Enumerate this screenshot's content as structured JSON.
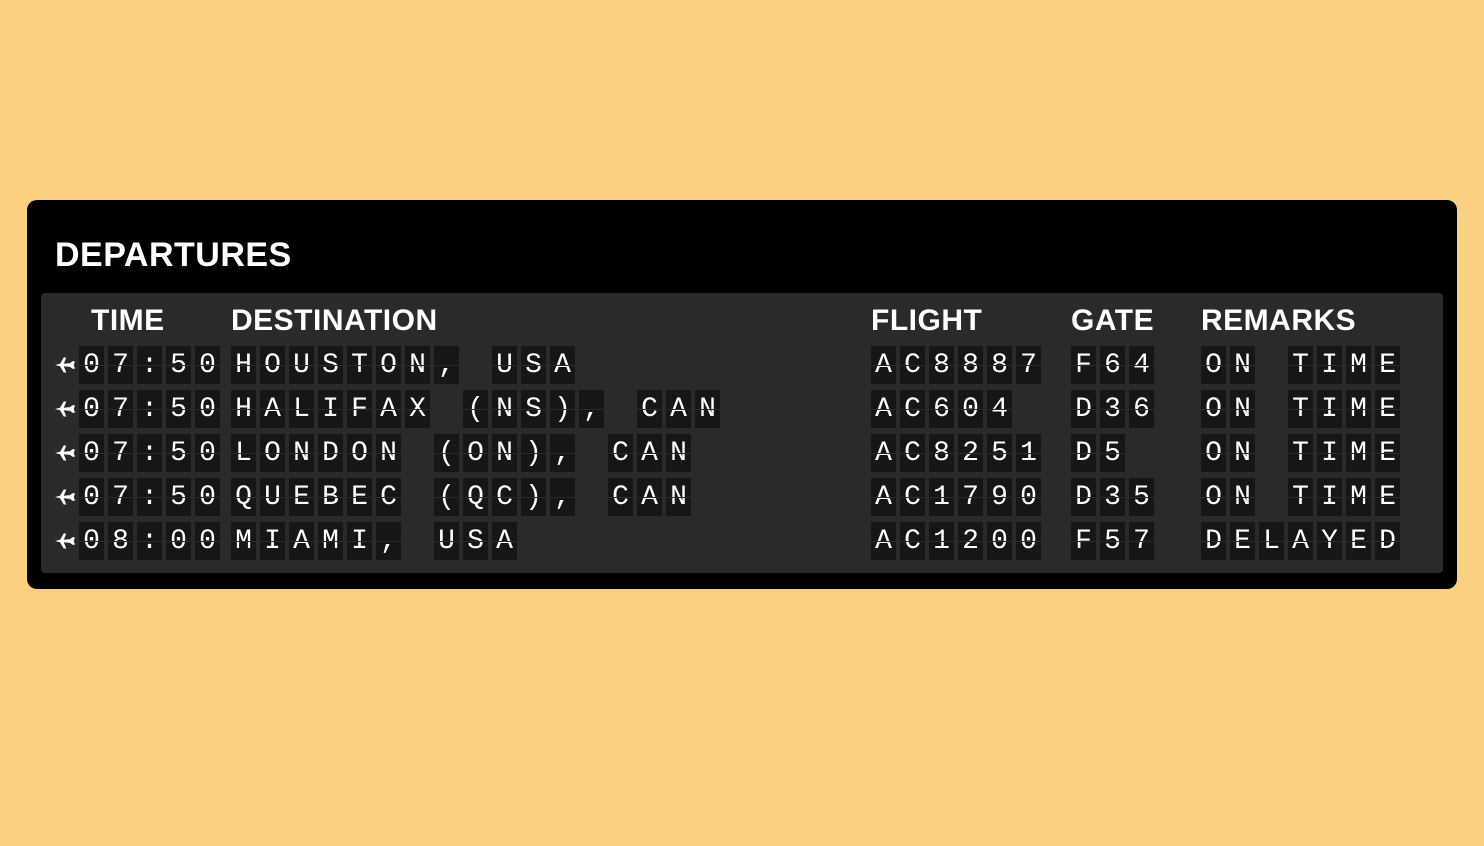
{
  "board": {
    "title": "DEPARTURES",
    "columns": {
      "time": "TIME",
      "destination": "DESTINATION",
      "flight": "FLIGHT",
      "gate": "GATE",
      "remarks": "REMARKS"
    },
    "rows": [
      {
        "time": "07:50",
        "destination": "HOUSTON, USA",
        "flight": "AC8887",
        "gate": "F64",
        "remarks": "ON TIME"
      },
      {
        "time": "07:50",
        "destination": "HALIFAX (NS), CAN",
        "flight": "AC604",
        "gate": "D36",
        "remarks": "ON TIME"
      },
      {
        "time": "07:50",
        "destination": "LONDON (ON), CAN",
        "flight": "AC8251",
        "gate": "D5",
        "remarks": "ON TIME"
      },
      {
        "time": "07:50",
        "destination": "QUEBEC (QC), CAN",
        "flight": "AC1790",
        "gate": "D35",
        "remarks": "ON TIME"
      },
      {
        "time": "08:00",
        "destination": "MIAMI, USA",
        "flight": "AC1200",
        "gate": "F57",
        "remarks": "DELAYED"
      }
    ]
  }
}
